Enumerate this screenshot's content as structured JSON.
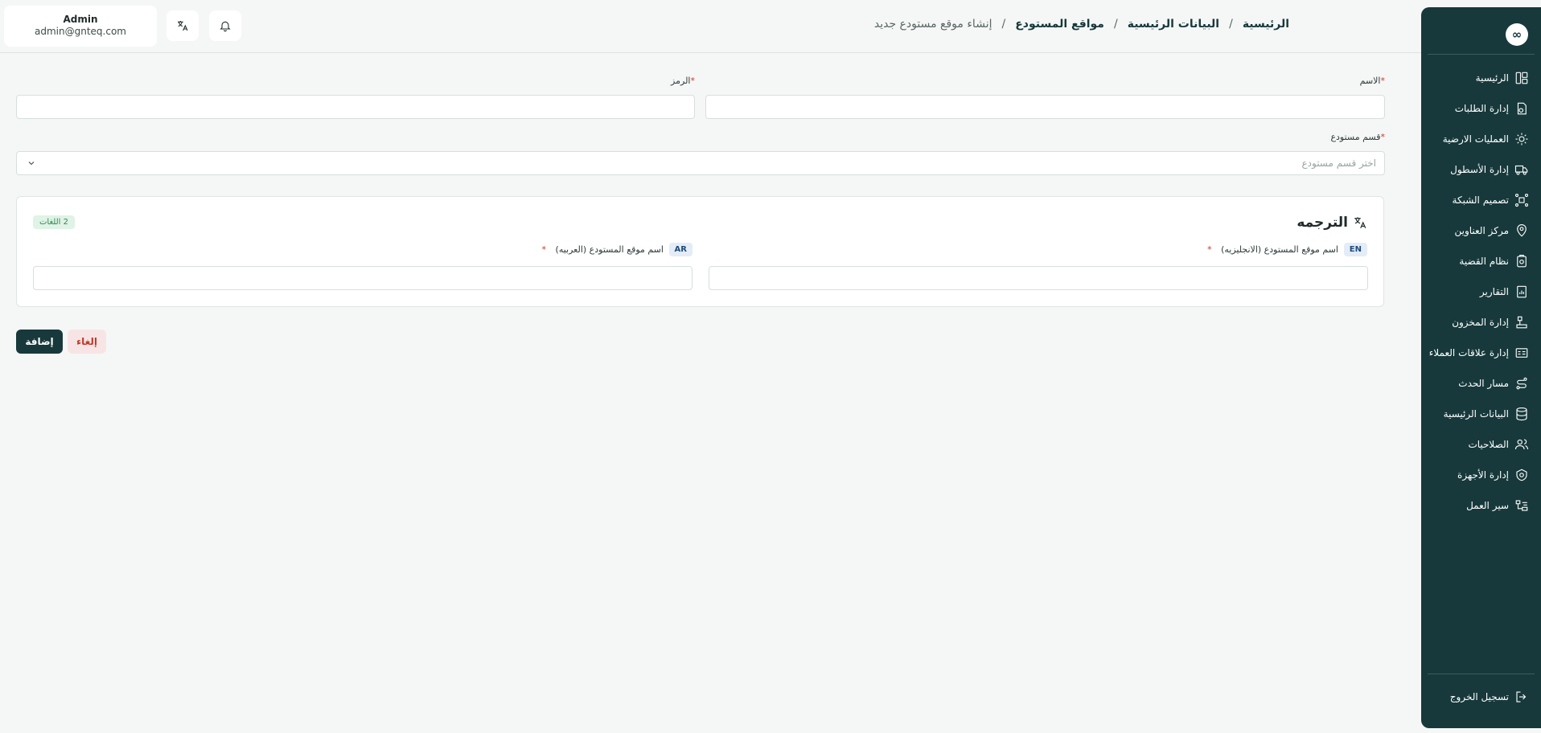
{
  "header": {
    "user": {
      "name": "Admin",
      "email": "admin@gnteq.com"
    },
    "breadcrumb": [
      "الرئيسية",
      "البيانات الرئيسية",
      "مواقع المستودع",
      "إنشاء موقع مستودع جديد"
    ],
    "separator": "/"
  },
  "sidebar": {
    "logo": "∞",
    "items": [
      {
        "label": "الرئيسية",
        "icon": "dashboard-icon"
      },
      {
        "label": "إدارة الطلبات",
        "icon": "orders-icon"
      },
      {
        "label": "العمليات الارضية",
        "icon": "operations-icon"
      },
      {
        "label": "إدارة الأسطول",
        "icon": "truck-icon"
      },
      {
        "label": "تصميم الشبكة",
        "icon": "network-icon"
      },
      {
        "label": "مركز العناوين",
        "icon": "location-icon"
      },
      {
        "label": "نظام القضية",
        "icon": "case-icon"
      },
      {
        "label": "التقارير",
        "icon": "report-icon"
      },
      {
        "label": "إدارة المخزون",
        "icon": "inventory-icon"
      },
      {
        "label": "إدارة علاقات العملاء",
        "icon": "crm-icon"
      },
      {
        "label": "مسار الحدث",
        "icon": "route-icon"
      },
      {
        "label": "البيانات الرئيسية",
        "icon": "database-icon"
      },
      {
        "label": "الصلاحيات",
        "icon": "users-icon"
      },
      {
        "label": "إدارة الأجهزة",
        "icon": "device-icon"
      },
      {
        "label": "سير العمل",
        "icon": "workflow-icon"
      }
    ],
    "logout": {
      "label": "تسجيل الخروج",
      "icon": "logout-icon"
    }
  },
  "form": {
    "name_label": "الاسم",
    "code_label": "الرمز",
    "required_mark": "*",
    "section_label": "قسم مستودع",
    "section_placeholder": "اختر قسم مستودع",
    "translation": {
      "title": "الترجمه",
      "languages_badge": "2 اللغات",
      "en": {
        "code": "EN",
        "label": "اسم موقع المستودع (الانجليزيه)"
      },
      "ar": {
        "code": "AR",
        "label": "اسم موقع المستودع (العربيه)"
      }
    },
    "add_button": "إضافة",
    "cancel_button": "إلغاء"
  },
  "colors": {
    "sidebar_bg": "#17393b",
    "primary": "#17393b",
    "danger": "#c0392b",
    "success": "#2c8a4e",
    "page_bg": "#f5f7f6"
  }
}
